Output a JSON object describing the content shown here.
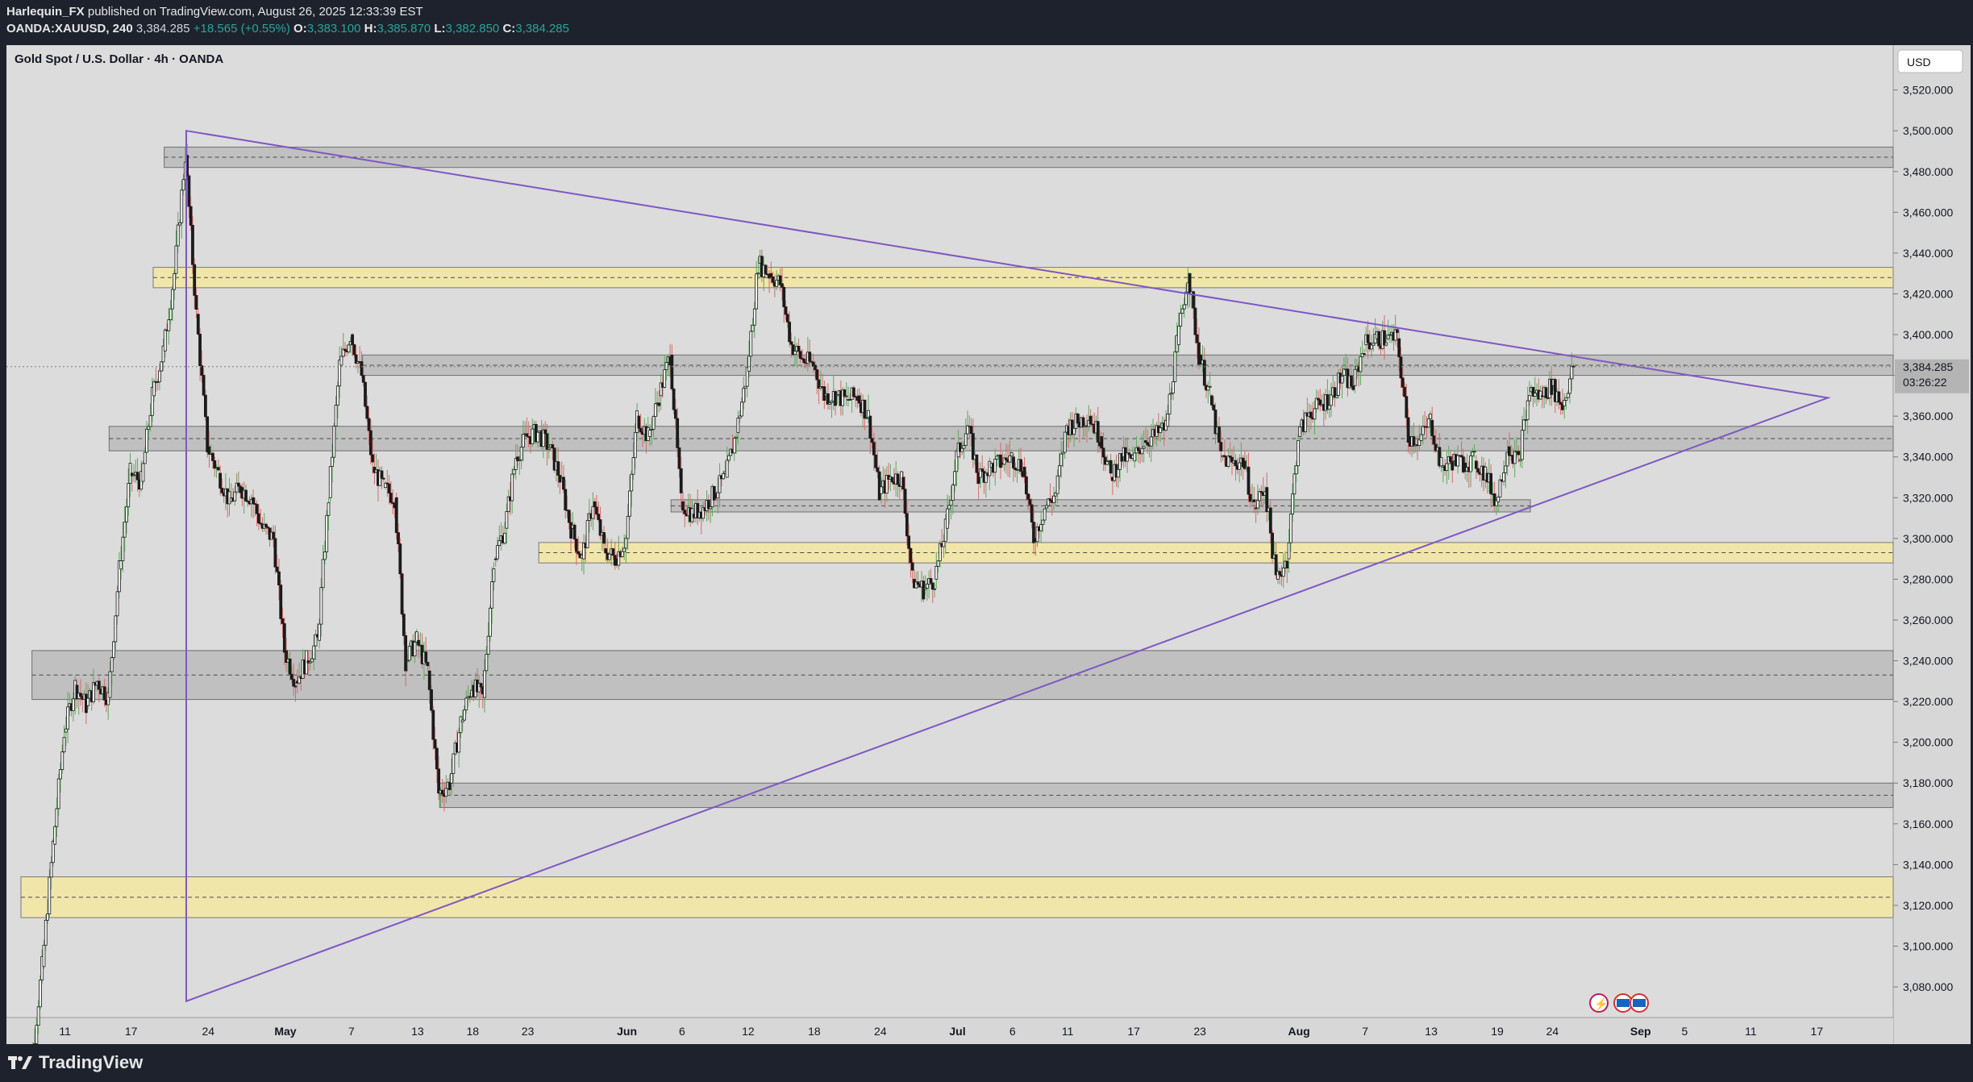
{
  "header": {
    "author": "Harlequin_FX",
    "published_text": "published on TradingView.com, August 26, 2025 12:33:39 EST",
    "symbol": "OANDA:XAUUSD, 240",
    "last": "3,384.285",
    "change": "+18.565 (+0.55%)",
    "open_label": "O:",
    "open": "3,383.100",
    "high_label": "H:",
    "high": "3,385.870",
    "low_label": "L:",
    "low": "3,382.850",
    "close_label": "C:",
    "close": "3,384.285"
  },
  "chart_data": {
    "type": "candlestick",
    "title": "Gold Spot / U.S. Dollar · 4h · OANDA",
    "currency": "USD",
    "ylim": [
      3065,
      3542
    ],
    "y_ticks": [
      3080,
      3100,
      3120,
      3140,
      3160,
      3180,
      3200,
      3220,
      3240,
      3260,
      3280,
      3300,
      3320,
      3340,
      3360,
      3380,
      3400,
      3420,
      3440,
      3460,
      3480,
      3500,
      3520
    ],
    "y_tick_labels": [
      "3,080.000",
      "3,100.000",
      "3,120.000",
      "3,140.000",
      "3,160.000",
      "3,180.000",
      "3,200.000",
      "3,220.000",
      "3,240.000",
      "3,260.000",
      "3,280.000",
      "3,300.000",
      "3,320.000",
      "3,340.000",
      "3,360.000",
      "3,380.000",
      "3,400.000",
      "3,420.000",
      "3,440.000",
      "3,460.000",
      "3,480.000",
      "3,500.000",
      "3,520.000"
    ],
    "x_tick_labels": [
      "11",
      "17",
      "24",
      "May",
      "7",
      "13",
      "18",
      "23",
      "Jun",
      "6",
      "12",
      "18",
      "24",
      "Jul",
      "6",
      "11",
      "17",
      "23",
      "Aug",
      "7",
      "13",
      "19",
      "24",
      "Sep",
      "5",
      "11",
      "17"
    ],
    "x_tick_dates": [
      "2025-04-11",
      "2025-04-17",
      "2025-04-24",
      "2025-05-01",
      "2025-05-07",
      "2025-05-13",
      "2025-05-18",
      "2025-05-23",
      "2025-06-01",
      "2025-06-06",
      "2025-06-12",
      "2025-06-18",
      "2025-06-24",
      "2025-07-01",
      "2025-07-06",
      "2025-07-11",
      "2025-07-17",
      "2025-07-23",
      "2025-08-01",
      "2025-08-07",
      "2025-08-13",
      "2025-08-19",
      "2025-08-24",
      "2025-09-01",
      "2025-09-05",
      "2025-09-11",
      "2025-09-17"
    ],
    "price_label": "3,384.285",
    "countdown_label": "03:26:22",
    "current_price": 3384.285,
    "zones": [
      {
        "type": "supply",
        "low": 3482,
        "high": 3492,
        "mid": 3487,
        "start": "2025-04-20",
        "color": "#9e9e9e"
      },
      {
        "type": "key",
        "low": 3423,
        "high": 3433,
        "mid": 3428,
        "start": "2025-04-19",
        "color": "#f5e7a0"
      },
      {
        "type": "supply",
        "low": 3380,
        "high": 3390,
        "mid": 3385,
        "start": "2025-05-08",
        "color": "#9e9e9e"
      },
      {
        "type": "supply",
        "low": 3343,
        "high": 3355,
        "mid": 3349,
        "start": "2025-04-15",
        "color": "#9e9e9e"
      },
      {
        "type": "supply",
        "low": 3313,
        "high": 3319,
        "mid": 3316,
        "start": "2025-06-05",
        "end": "2025-08-22",
        "color": "#9e9e9e"
      },
      {
        "type": "key",
        "low": 3288,
        "high": 3298,
        "mid": 3293,
        "start": "2025-05-24",
        "color": "#f5e7a0"
      },
      {
        "type": "demand",
        "low": 3221,
        "high": 3245,
        "mid": 3233,
        "start": "2025-04-08",
        "color": "#9e9e9e"
      },
      {
        "type": "demand",
        "low": 3168,
        "high": 3180,
        "mid": 3174,
        "start": "2025-05-15",
        "color": "#9e9e9e"
      },
      {
        "type": "key",
        "low": 3114,
        "high": 3134,
        "mid": 3124,
        "start": "2025-04-07",
        "color": "#f5e7a0"
      }
    ],
    "triangle": {
      "color": "#7e57c2",
      "points": [
        {
          "date": "2025-04-22",
          "price": 3500
        },
        {
          "date": "2025-09-18",
          "price": 3369
        },
        {
          "date": "2025-04-22",
          "price": 3073
        }
      ],
      "left_edge": [
        {
          "date": "2025-04-22",
          "price": 3500
        },
        {
          "date": "2025-04-22",
          "price": 3073
        }
      ]
    },
    "candles_close_path": [
      [
        "2025-04-07",
        3012
      ],
      [
        "2025-04-08",
        3040
      ],
      [
        "2025-04-09",
        3090
      ],
      [
        "2025-04-10",
        3150
      ],
      [
        "2025-04-11",
        3205
      ],
      [
        "2025-04-12",
        3228
      ],
      [
        "2025-04-13",
        3218
      ],
      [
        "2025-04-14",
        3230
      ],
      [
        "2025-04-15",
        3222
      ],
      [
        "2025-04-16",
        3285
      ],
      [
        "2025-04-17",
        3332
      ],
      [
        "2025-04-18",
        3328
      ],
      [
        "2025-04-19",
        3370
      ],
      [
        "2025-04-20",
        3392
      ],
      [
        "2025-04-21",
        3430
      ],
      [
        "2025-04-22",
        3488
      ],
      [
        "2025-04-23",
        3410
      ],
      [
        "2025-04-24",
        3345
      ],
      [
        "2025-04-25",
        3332
      ],
      [
        "2025-04-26",
        3318
      ],
      [
        "2025-04-27",
        3325
      ],
      [
        "2025-04-28",
        3320
      ],
      [
        "2025-04-29",
        3305
      ],
      [
        "2025-04-30",
        3300
      ],
      [
        "2025-05-01",
        3245
      ],
      [
        "2025-05-02",
        3230
      ],
      [
        "2025-05-03",
        3240
      ],
      [
        "2025-05-04",
        3250
      ],
      [
        "2025-05-05",
        3320
      ],
      [
        "2025-05-06",
        3385
      ],
      [
        "2025-05-07",
        3400
      ],
      [
        "2025-05-08",
        3380
      ],
      [
        "2025-05-09",
        3335
      ],
      [
        "2025-05-10",
        3325
      ],
      [
        "2025-05-11",
        3320
      ],
      [
        "2025-05-12",
        3240
      ],
      [
        "2025-05-13",
        3250
      ],
      [
        "2025-05-14",
        3235
      ],
      [
        "2025-05-15",
        3175
      ],
      [
        "2025-05-16",
        3180
      ],
      [
        "2025-05-17",
        3210
      ],
      [
        "2025-05-18",
        3228
      ],
      [
        "2025-05-19",
        3222
      ],
      [
        "2025-05-20",
        3290
      ],
      [
        "2025-05-21",
        3305
      ],
      [
        "2025-05-22",
        3340
      ],
      [
        "2025-05-23",
        3350
      ],
      [
        "2025-05-24",
        3352
      ],
      [
        "2025-05-25",
        3345
      ],
      [
        "2025-05-26",
        3330
      ],
      [
        "2025-05-27",
        3305
      ],
      [
        "2025-05-28",
        3290
      ],
      [
        "2025-05-29",
        3318
      ],
      [
        "2025-05-30",
        3295
      ],
      [
        "2025-05-31",
        3290
      ],
      [
        "2025-06-01",
        3300
      ],
      [
        "2025-06-02",
        3360
      ],
      [
        "2025-06-03",
        3350
      ],
      [
        "2025-06-04",
        3370
      ],
      [
        "2025-06-05",
        3390
      ],
      [
        "2025-06-06",
        3318
      ],
      [
        "2025-06-07",
        3312
      ],
      [
        "2025-06-08",
        3315
      ],
      [
        "2025-06-09",
        3322
      ],
      [
        "2025-06-10",
        3330
      ],
      [
        "2025-06-11",
        3352
      ],
      [
        "2025-06-12",
        3382
      ],
      [
        "2025-06-13",
        3435
      ],
      [
        "2025-06-14",
        3430
      ],
      [
        "2025-06-15",
        3425
      ],
      [
        "2025-06-16",
        3395
      ],
      [
        "2025-06-17",
        3388
      ],
      [
        "2025-06-18",
        3385
      ],
      [
        "2025-06-19",
        3370
      ],
      [
        "2025-06-20",
        3370
      ],
      [
        "2025-06-21",
        3368
      ],
      [
        "2025-06-22",
        3370
      ],
      [
        "2025-06-23",
        3360
      ],
      [
        "2025-06-24",
        3322
      ],
      [
        "2025-06-25",
        3330
      ],
      [
        "2025-06-26",
        3330
      ],
      [
        "2025-06-27",
        3280
      ],
      [
        "2025-06-28",
        3275
      ],
      [
        "2025-06-29",
        3280
      ],
      [
        "2025-06-30",
        3305
      ],
      [
        "2025-07-01",
        3340
      ],
      [
        "2025-07-02",
        3355
      ],
      [
        "2025-07-03",
        3330
      ],
      [
        "2025-07-04",
        3335
      ],
      [
        "2025-07-05",
        3337
      ],
      [
        "2025-07-06",
        3340
      ],
      [
        "2025-07-07",
        3335
      ],
      [
        "2025-07-08",
        3300
      ],
      [
        "2025-07-09",
        3315
      ],
      [
        "2025-07-10",
        3322
      ],
      [
        "2025-07-11",
        3355
      ],
      [
        "2025-07-12",
        3357
      ],
      [
        "2025-07-13",
        3360
      ],
      [
        "2025-07-14",
        3350
      ],
      [
        "2025-07-15",
        3330
      ],
      [
        "2025-07-16",
        3340
      ],
      [
        "2025-07-17",
        3338
      ],
      [
        "2025-07-18",
        3348
      ],
      [
        "2025-07-19",
        3350
      ],
      [
        "2025-07-20",
        3355
      ],
      [
        "2025-07-21",
        3395
      ],
      [
        "2025-07-22",
        3430
      ],
      [
        "2025-07-23",
        3390
      ],
      [
        "2025-07-24",
        3370
      ],
      [
        "2025-07-25",
        3340
      ],
      [
        "2025-07-26",
        3337
      ],
      [
        "2025-07-27",
        3338
      ],
      [
        "2025-07-28",
        3315
      ],
      [
        "2025-07-29",
        3325
      ],
      [
        "2025-07-30",
        3280
      ],
      [
        "2025-07-31",
        3290
      ],
      [
        "2025-08-01",
        3350
      ],
      [
        "2025-08-02",
        3362
      ],
      [
        "2025-08-03",
        3365
      ],
      [
        "2025-08-04",
        3370
      ],
      [
        "2025-08-05",
        3380
      ],
      [
        "2025-08-06",
        3375
      ],
      [
        "2025-08-07",
        3395
      ],
      [
        "2025-08-08",
        3398
      ],
      [
        "2025-08-09",
        3398
      ],
      [
        "2025-08-10",
        3398
      ],
      [
        "2025-08-11",
        3350
      ],
      [
        "2025-08-12",
        3348
      ],
      [
        "2025-08-13",
        3358
      ],
      [
        "2025-08-14",
        3335
      ],
      [
        "2025-08-15",
        3338
      ],
      [
        "2025-08-16",
        3337
      ],
      [
        "2025-08-17",
        3338
      ],
      [
        "2025-08-18",
        3332
      ],
      [
        "2025-08-19",
        3318
      ],
      [
        "2025-08-20",
        3345
      ],
      [
        "2025-08-21",
        3338
      ],
      [
        "2025-08-22",
        3372
      ],
      [
        "2025-08-23",
        3370
      ],
      [
        "2025-08-24",
        3375
      ],
      [
        "2025-08-25",
        3365
      ],
      [
        "2025-08-26",
        3384.285
      ]
    ]
  },
  "footer": {
    "brand": "TradingView"
  }
}
